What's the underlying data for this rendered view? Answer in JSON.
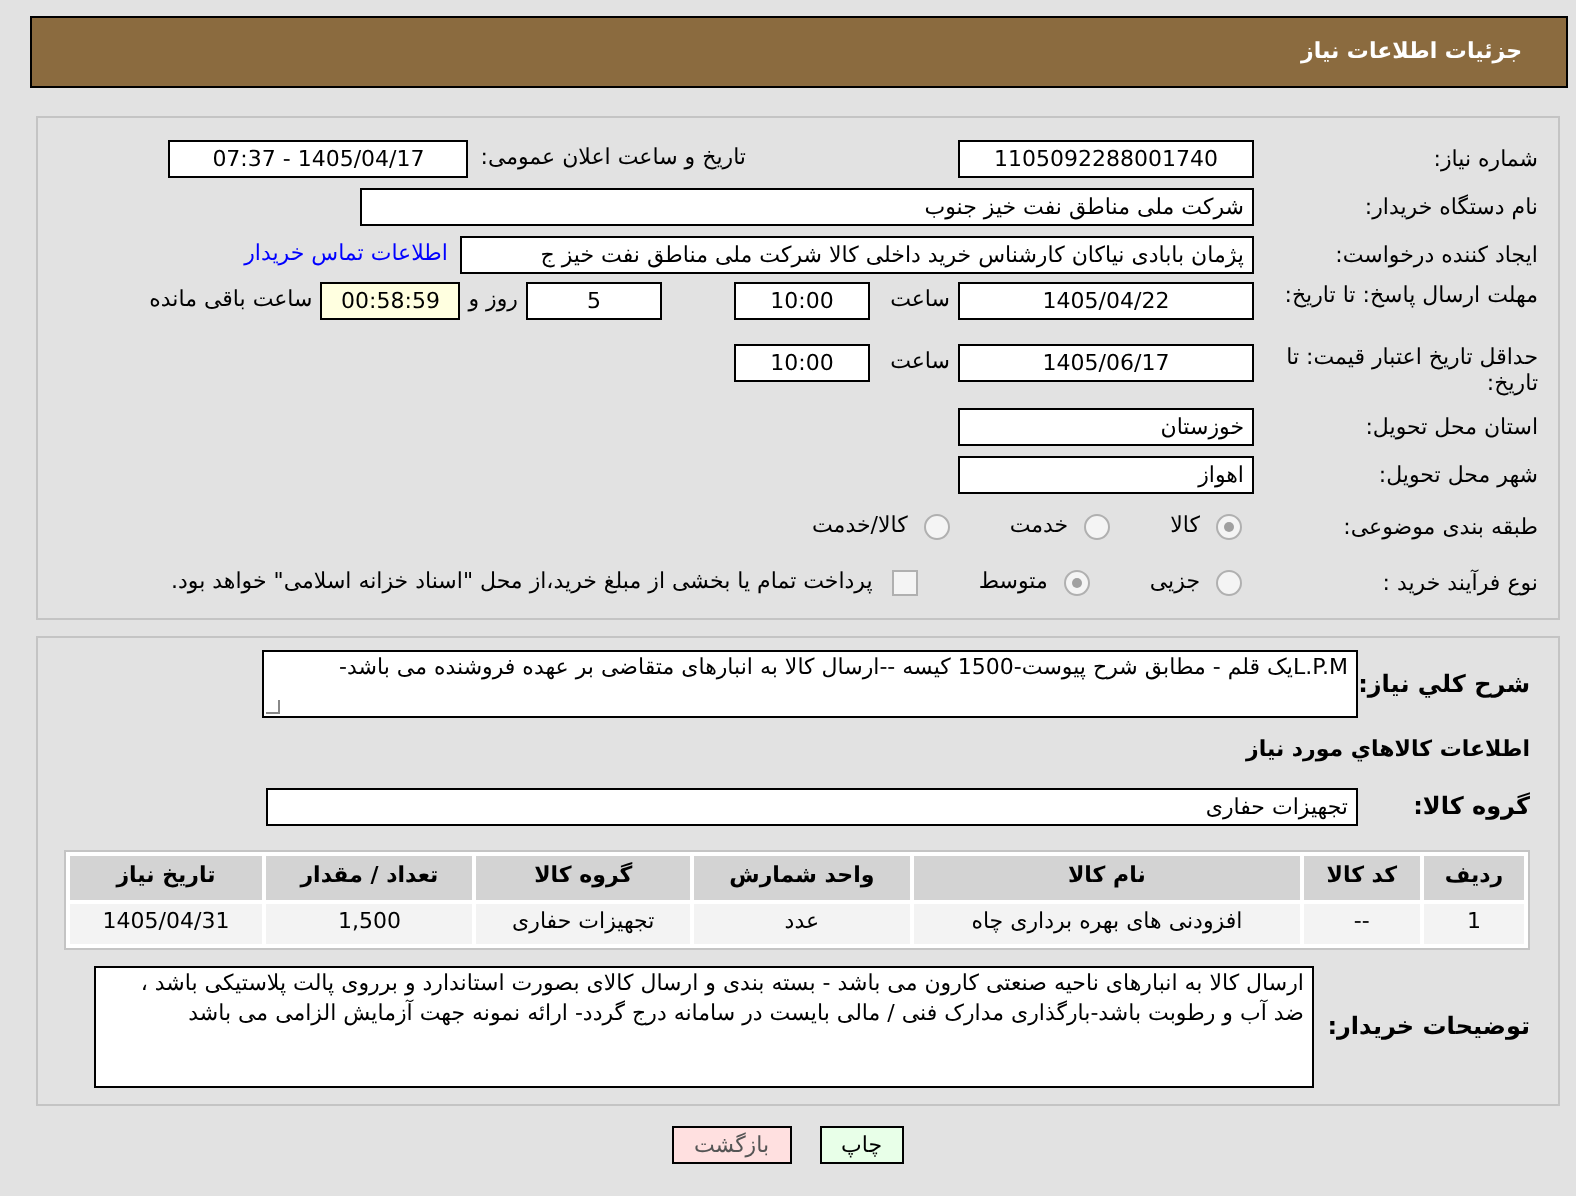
{
  "header": {
    "title": "جزئیات اطلاعات نیاز"
  },
  "need_number": {
    "label": "شماره نیاز:",
    "value": "1105092288001740"
  },
  "announce": {
    "label": "تاریخ و ساعت اعلان عمومی:",
    "value": "1405/04/17 - 07:37"
  },
  "buyer_org": {
    "label": "نام دستگاه خریدار:",
    "value": "شرکت ملی مناطق نفت خیز جنوب"
  },
  "requester": {
    "label": "ایجاد کننده درخواست:",
    "value": "پژمان  بابادی نیاکان  کارشناس خرید داخلی کالا  شرکت ملی مناطق نفت خیز ج",
    "link": "اطلاعات تماس خریدار"
  },
  "reply_deadline": {
    "label": "مهلت ارسال پاسخ: تا تاریخ:",
    "date": "1405/04/22",
    "time_label": "ساعت",
    "time": "10:00",
    "days": "5",
    "days_label": "روز و",
    "remaining": "00:58:59",
    "remaining_label": "ساعت باقی مانده"
  },
  "price_validity": {
    "label": "حداقل تاریخ اعتبار قیمت: تا تاریخ:",
    "date": "1405/06/17",
    "time_label": "ساعت",
    "time": "10:00"
  },
  "province": {
    "label": "استان محل تحویل:",
    "value": "خوزستان"
  },
  "city": {
    "label": "شهر محل تحویل:",
    "value": "اهواز"
  },
  "category": {
    "label": "طبقه بندی موضوعی:",
    "options": [
      {
        "label": "کالا",
        "selected": true
      },
      {
        "label": "خدمت",
        "selected": false
      },
      {
        "label": "کالا/خدمت",
        "selected": false
      }
    ]
  },
  "purchase_type": {
    "label": "نوع فرآیند خرید :",
    "options": [
      {
        "label": "جزیی",
        "selected": false
      },
      {
        "label": "متوسط",
        "selected": true
      }
    ],
    "treasury": {
      "checked": false,
      "text": "پرداخت تمام یا بخشی از مبلغ خرید،از محل \"اسناد خزانه اسلامی\" خواهد بود."
    }
  },
  "description": {
    "label": "شرح کلي نياز:",
    "value": "L.P.Mیک قلم - مطابق شرح پیوست-1500 کیسه --ارسال کالا به انبارهای متقاضی بر عهده فروشنده می باشد-"
  },
  "goods_heading": "اطلاعات کالاهاي مورد نياز",
  "goods_group": {
    "label": "گروه کالا:",
    "value": "تجهیزات حفاری"
  },
  "table": {
    "columns": [
      "ردیف",
      "کد کالا",
      "نام کالا",
      "واحد شمارش",
      "گروه کالا",
      "تعداد / مقدار",
      "تاریخ نیاز"
    ],
    "rows": [
      [
        "1",
        "--",
        "افزودنی های بهره برداری چاه",
        "عدد",
        "تجهیزات حفاری",
        "1,500",
        "1405/04/31"
      ]
    ]
  },
  "buyer_notes": {
    "label": "توضیحات خریدار:",
    "value": "ارسال کالا به انبارهای  ناحیه صنعتی  کارون می باشد  - بسته بندی و ارسال کالای بصورت استاندارد و برروی پالت پلاستیکی باشد ، ضد آب و رطوبت باشد-بارگذاری مدارک فنی / مالی بایست  در سامانه درج گردد- ارائه نمونه جهت آزمایش الزامی می باشد"
  },
  "buttons": [
    {
      "label": "چاپ",
      "kind": "print"
    },
    {
      "label": "بازگشت",
      "kind": "back"
    }
  ]
}
